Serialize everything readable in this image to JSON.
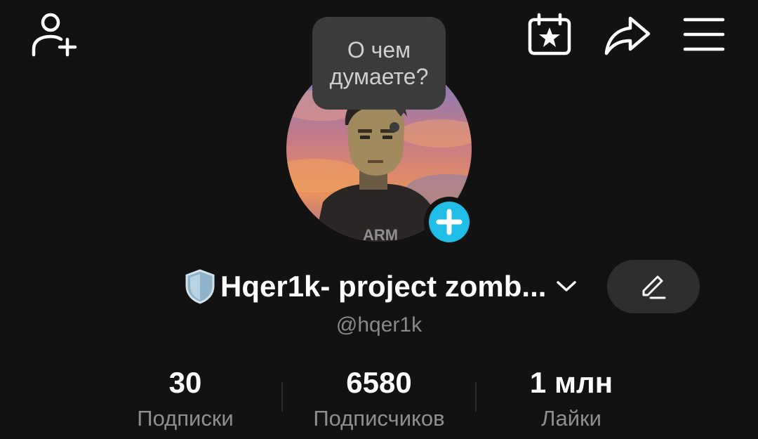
{
  "header": {
    "icons": [
      "add-friend-icon",
      "calendar-star-icon",
      "share-icon",
      "menu-icon"
    ]
  },
  "status_bubble": {
    "text_line1": "О чем",
    "text_line2": "думаете?"
  },
  "profile": {
    "name_emoji": "🛡️",
    "display_name": "Hqer1k- project zomb...",
    "handle": "@hqer1k",
    "accent_color": "#20bde6"
  },
  "stats": {
    "following": {
      "value": "30",
      "label": "Подписки"
    },
    "followers": {
      "value": "6580",
      "label": "Подписчиков"
    },
    "likes": {
      "value": "1 млн",
      "label": "Лайки"
    }
  }
}
